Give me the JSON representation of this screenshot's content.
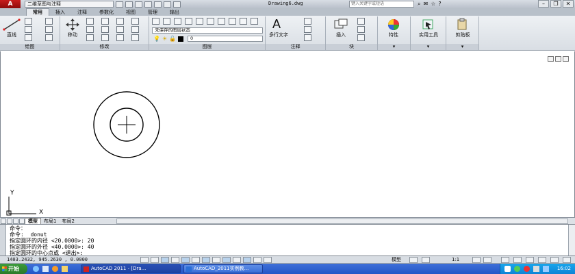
{
  "title_bar": {
    "app_button": "A",
    "workspace": "二维草图与注释",
    "document_title": "Drawing6.dwg",
    "search_placeholder": "键入关键字或短语"
  },
  "ribbon_tabs": [
    "常用",
    "插入",
    "注释",
    "参数化",
    "视图",
    "管理",
    "输出"
  ],
  "ribbon": {
    "draw_panel": {
      "footer": "绘图",
      "line_label": "直线"
    },
    "modify_panel": {
      "footer": "修改",
      "move_label": "移动"
    },
    "layers_panel": {
      "footer": "图层",
      "layer_state": "未保存的图层状态",
      "current_layer": "0"
    },
    "annotation_panel": {
      "footer": "注释",
      "mtext_label": "多行文字"
    },
    "block_panel": {
      "footer": "块",
      "insert_label": "插入"
    },
    "properties_panel": {
      "label": "特性"
    },
    "utilities_panel": {
      "label": "实用工具"
    },
    "clipboard_panel": {
      "label": "剪贴板"
    }
  },
  "ucs": {
    "y_label": "Y",
    "x_label": "X"
  },
  "layout_tabs": [
    "模型",
    "布局1",
    "布局2"
  ],
  "command_window": {
    "lines": [
      "命令：",
      "命令:  donut",
      "指定圆环的内径 <20.0000>: 20",
      "指定圆环的外径 <40.0000>: 40",
      "指定圆环的中心点或 <退出>:"
    ]
  },
  "status_bar": {
    "coordinates": "1403.2432, 945.2630 , 0.0000",
    "space": "模型",
    "scale": "1:1"
  },
  "taskbar": {
    "start": "开始",
    "tasks": [
      "AutoCAD 2011 - [Dra...",
      "AutoCAD_2011实例教..."
    ],
    "clock": "16:02"
  },
  "colors": {
    "app_red": "#b01414",
    "ribbon_bg": "#e3e7ec",
    "taskbar_blue": "#2d5fcf",
    "start_green": "#2f8a2f",
    "drawing_bg": "#ffffff"
  }
}
